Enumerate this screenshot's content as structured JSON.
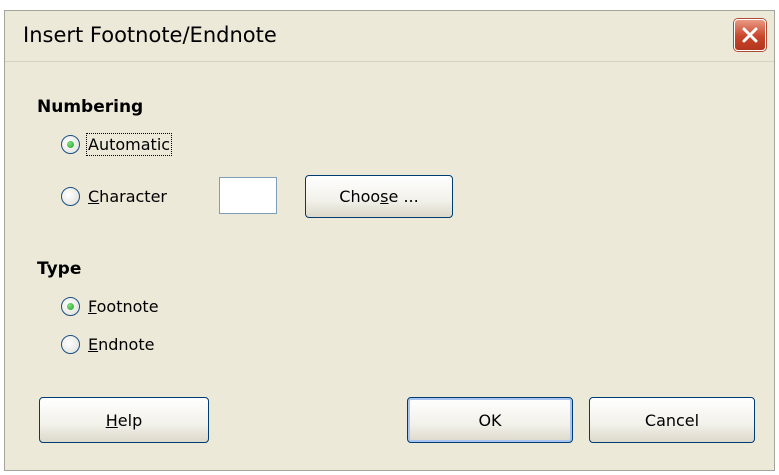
{
  "dialog": {
    "title": "Insert Footnote/Endnote"
  },
  "numbering": {
    "heading": "Numbering",
    "automatic": {
      "label": "Automatic",
      "checked": true
    },
    "character": {
      "pre": "",
      "mnemonic": "C",
      "post": "haracter",
      "checked": false,
      "value": ""
    },
    "choose_button": {
      "pre": "Choo",
      "mnemonic": "s",
      "post": "e ..."
    }
  },
  "type": {
    "heading": "Type",
    "footnote": {
      "mnemonic": "F",
      "post": "ootnote",
      "checked": true
    },
    "endnote": {
      "mnemonic": "E",
      "post": "ndnote",
      "checked": false
    }
  },
  "buttons": {
    "help": {
      "mnemonic": "H",
      "post": "elp"
    },
    "ok": "OK",
    "cancel": "Cancel"
  },
  "icons": {
    "close": "close-icon"
  },
  "colors": {
    "dialog_bg": "#ece9d8",
    "close_button": "#c8452a",
    "button_border": "#003c74",
    "radio_check": "#21a121"
  }
}
